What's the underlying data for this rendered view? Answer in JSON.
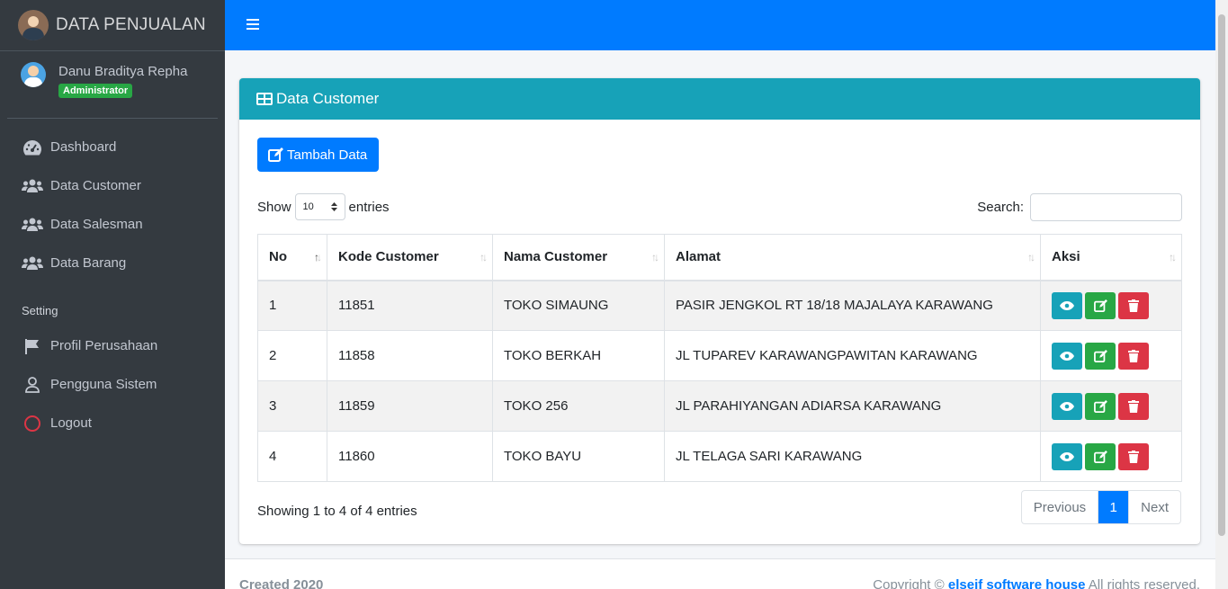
{
  "brand": {
    "title": "DATA PENJUALAN"
  },
  "user": {
    "name": "Danu Braditya Repha",
    "role": "Administrator"
  },
  "sidebar": {
    "items": [
      {
        "label": "Dashboard"
      },
      {
        "label": "Data Customer"
      },
      {
        "label": "Data Salesman"
      },
      {
        "label": "Data Barang"
      }
    ],
    "setting_header": "Setting",
    "setting_items": [
      {
        "label": "Profil Perusahaan"
      },
      {
        "label": "Pengguna Sistem"
      },
      {
        "label": "Logout"
      }
    ]
  },
  "card": {
    "title": "Data Customer",
    "add_button": "Tambah Data",
    "show_label": "Show",
    "entries_label": "entries",
    "page_length": "10",
    "search_label": "Search:",
    "search_value": ""
  },
  "table": {
    "headers": [
      "No",
      "Kode Customer",
      "Nama Customer",
      "Alamat",
      "Aksi"
    ],
    "rows": [
      {
        "no": "1",
        "kode": "11851",
        "nama": "TOKO SIMAUNG",
        "alamat": "PASIR JENGKOL RT 18/18 MAJALAYA KARAWANG"
      },
      {
        "no": "2",
        "kode": "11858",
        "nama": "TOKO BERKAH",
        "alamat": "JL TUPAREV KARAWANGPAWITAN KARAWANG"
      },
      {
        "no": "3",
        "kode": "11859",
        "nama": "TOKO 256",
        "alamat": "JL PARAHIYANGAN ADIARSA KARAWANG"
      },
      {
        "no": "4",
        "kode": "11860",
        "nama": "TOKO BAYU",
        "alamat": "JL TELAGA SARI KARAWANG"
      }
    ]
  },
  "info": "Showing 1 to 4 of 4 entries",
  "pagination": {
    "previous": "Previous",
    "current": "1",
    "next": "Next"
  },
  "footer": {
    "created": "Created 2020",
    "copyright_prefix": "Copyright ©",
    "company": "elseif software house",
    "rights": "All rights reserved."
  },
  "colors": {
    "primary": "#007bff",
    "info": "#17a2b8",
    "success": "#28a745",
    "danger": "#dc3545",
    "sidebar": "#343a40"
  }
}
